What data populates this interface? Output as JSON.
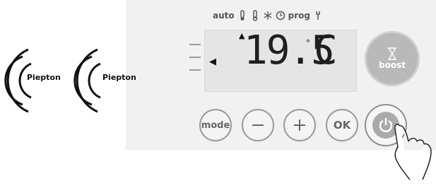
{
  "indicators": {
    "auto_label": "auto",
    "prog_label": "prog",
    "icons": [
      "thermometer-comfort-icon",
      "thermometer-eco-icon",
      "snowflake-icon",
      "clock-icon",
      "prog-icon",
      "wrench-icon"
    ]
  },
  "display": {
    "temperature": "19.5",
    "degree_symbol": "°",
    "unit": "C"
  },
  "buttons": {
    "boost_label": "boost",
    "mode_label": "mode",
    "minus_label": "—",
    "plus_label": "+",
    "ok_label": "OK"
  },
  "signals": [
    {
      "label": "Piepton"
    },
    {
      "label": "Piepton"
    }
  ],
  "colors": {
    "panel": "#f1f1f1",
    "lcd": "#e5e5e5",
    "button_border": "#9a9a9a",
    "boost_fill": "#b9b9b9",
    "power_fill": "#aaaaaa"
  }
}
